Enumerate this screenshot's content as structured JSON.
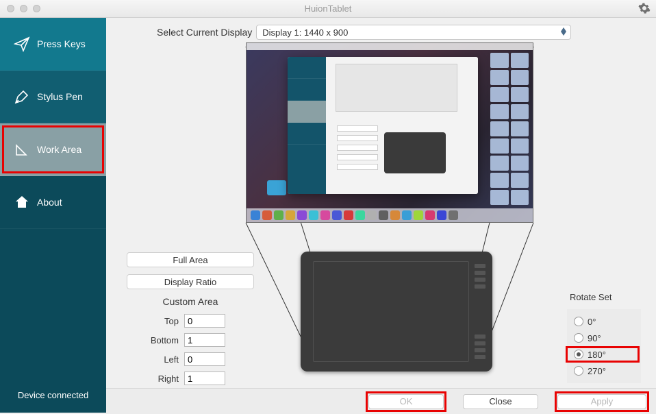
{
  "window": {
    "title": "HuionTablet"
  },
  "sidebar": {
    "items": [
      {
        "label": "Press Keys"
      },
      {
        "label": "Stylus Pen"
      },
      {
        "label": "Work Area"
      },
      {
        "label": "About"
      }
    ],
    "status": "Device connected"
  },
  "display": {
    "label": "Select Current Display",
    "selected": "Display 1: 1440 x  900"
  },
  "area_controls": {
    "full_area": "Full Area",
    "display_ratio": "Display Ratio",
    "custom_area": "Custom Area",
    "top_label": "Top",
    "bottom_label": "Bottom",
    "left_label": "Left",
    "right_label": "Right",
    "top": "0",
    "bottom": "1",
    "left": "0",
    "right": "1"
  },
  "rotate": {
    "title": "Rotate Set",
    "options": [
      {
        "label": "0°",
        "selected": false
      },
      {
        "label": "90°",
        "selected": false
      },
      {
        "label": "180°",
        "selected": true
      },
      {
        "label": "270°",
        "selected": false
      }
    ]
  },
  "footer": {
    "ok": "OK",
    "close": "Close",
    "apply": "Apply"
  },
  "highlights": {
    "sidebar_item": 2,
    "rotate_option": 2,
    "footer_buttons": [
      "ok",
      "apply"
    ]
  }
}
